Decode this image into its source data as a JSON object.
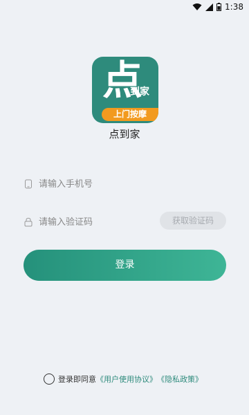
{
  "status_bar": {
    "time": "1:38",
    "icons": [
      "wifi-icon",
      "signal-icon",
      "battery-icon"
    ]
  },
  "app": {
    "logo_main": "点",
    "logo_sub": "到家",
    "logo_band": "上门按摩",
    "name": "点到家"
  },
  "form": {
    "phone_placeholder": "请输入手机号",
    "code_placeholder": "请输入验证码",
    "get_code_label": "获取验证码",
    "login_label": "登录"
  },
  "agreement": {
    "prefix": "登录即同意",
    "user_agreement": "《用户使用协议》",
    "privacy_policy": "《隐私政策》"
  },
  "colors": {
    "primary": "#2e8b7c",
    "accent": "#f29a1f",
    "background": "#eef1f5"
  }
}
